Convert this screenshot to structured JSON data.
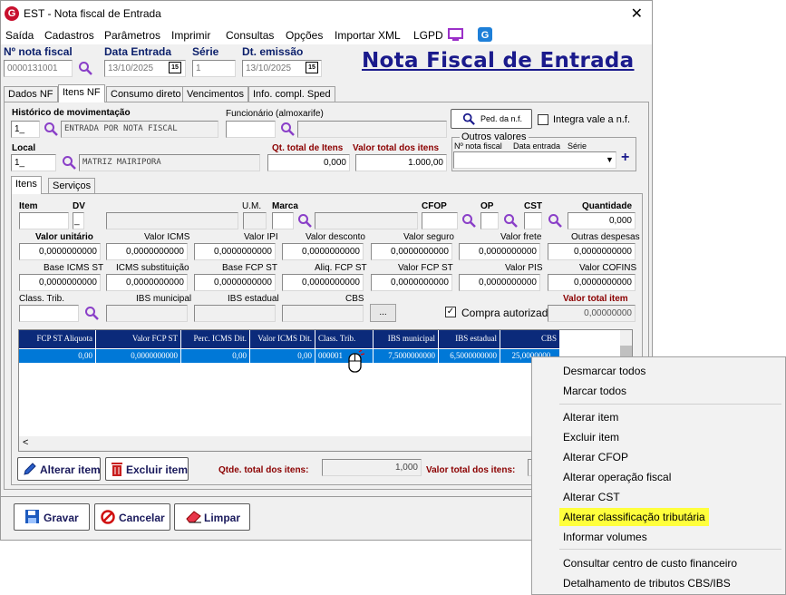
{
  "window": {
    "title": "EST - Nota fiscal de Entrada",
    "close": "✕",
    "logo": "G"
  },
  "menu": [
    "Saída",
    "Cadastros",
    "Parâmetros",
    "Imprimir",
    "Consultas",
    "Opções",
    "Importar XML",
    "LGPD"
  ],
  "header": {
    "nota_label": "Nº nota fiscal",
    "nota_value": "0000131001",
    "data_entrada_label": "Data Entrada",
    "data_entrada_value": "13/10/2025",
    "serie_label": "Série",
    "serie_value": "1",
    "emissao_label": "Dt. emissão",
    "emissao_value": "13/10/2025",
    "calendar_glyph": "15",
    "big_title": "Nota Fiscal de Entrada"
  },
  "tabs": [
    "Dados NF",
    "Itens NF",
    "Consumo direto",
    "Vencimentos",
    "Info. compl. Sped"
  ],
  "itens_nf": {
    "historico_label": "Histórico de movimentação",
    "historico_code": "1_",
    "historico_desc": "ENTRADA POR NOTA FISCAL",
    "funcionario_label": "Funcionário (almoxarife)",
    "funcionario_value": "",
    "ped_button": "Ped. da n.f.",
    "integra_label": "Integra vale a n.f.",
    "local_label": "Local",
    "local_code": "1_",
    "local_desc": "MATRIZ MAIRIPORA",
    "qt_total_label": "Qt. total de Itens",
    "qt_total_value": "0,000",
    "valor_total_label": "Valor total dos itens",
    "valor_total_value": "1.000,00",
    "outros_label": "Outros valores",
    "outros_cols": [
      "Nº nota fiscal",
      "Data entrada",
      "Série"
    ],
    "plus": "+"
  },
  "subtabs": [
    "Itens",
    "Serviços"
  ],
  "item_form": {
    "item_label": "Item",
    "dv_label": "DV",
    "dv_value": "_",
    "um_label": "U.M.",
    "marca_label": "Marca",
    "cfop_label": "CFOP",
    "op_label": "OP",
    "cst_label": "CST",
    "quantidade_label": "Quantidade",
    "quantidade_value": "0,000",
    "row1_labels": [
      "Valor unitário",
      "Valor ICMS",
      "Valor IPI",
      "Valor desconto",
      "Valor seguro",
      "Valor frete",
      "Outras despesas"
    ],
    "row2_labels": [
      "Base ICMS ST",
      "ICMS substituição",
      "Base FCP ST",
      "Aliq. FCP ST",
      "Valor FCP ST",
      "Valor PIS",
      "Valor COFINS"
    ],
    "zero": "0,0000000000",
    "class_label": "Class. Trib.",
    "ibs_mun_label": "IBS municipal",
    "ibs_est_label": "IBS estadual",
    "cbs_label": "CBS",
    "ellipsis": "...",
    "compra_label": "Compra autorizada",
    "valor_total_item_label": "Valor total item",
    "valor_total_item_value": "0,00000000"
  },
  "grid": {
    "headers": [
      "FCP ST Aliquota",
      "Valor FCP ST",
      "Perc. ICMS Dit.",
      "Valor ICMS Dit.",
      "Class. Trib.",
      "IBS municipal",
      "IBS estadual",
      "CBS"
    ],
    "row": [
      "0,00",
      "0,0000000000",
      "0,00",
      "0,00",
      "000001",
      "7,5000000000",
      "6,5000000000",
      "25,0000000..."
    ],
    "scroll_left": "<"
  },
  "footer": {
    "alterar_item": "Alterar item",
    "excluir_item": "Excluir item",
    "qtde_label": "Qtde. total dos itens:",
    "qtde_value": "1,000",
    "valor_total_label": "Valor total dos itens:",
    "gravar": "Gravar",
    "cancelar": "Cancelar",
    "limpar": "Limpar"
  },
  "context_menu": {
    "group1": [
      "Desmarcar todos",
      "Marcar todos"
    ],
    "group2": [
      "Alterar item",
      "Excluir item",
      "Alterar CFOP",
      "Alterar operação fiscal",
      "Alterar CST",
      "Alterar classificação tributária",
      "Informar volumes"
    ],
    "group3": [
      "Consultar centro de custo financeiro",
      "Detalhamento de tributos CBS/IBS"
    ],
    "highlight_color": "#ffff3c"
  },
  "colors": {
    "accent": "#0b1f6b",
    "grid_header": "#0b2a7a",
    "selected_row": "#0078d7",
    "label_red": "#8b0000",
    "logo_red": "#c8102e"
  }
}
